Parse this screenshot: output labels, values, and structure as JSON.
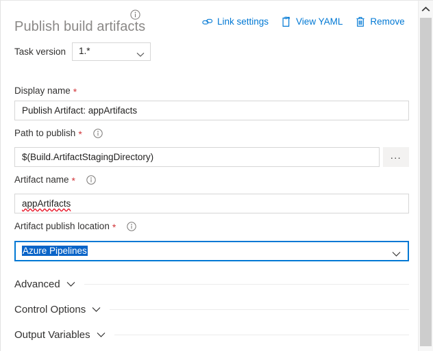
{
  "header": {
    "title": "Publish build artifacts",
    "title_info_icon": "info-icon",
    "toolbar": [
      {
        "label": "Link settings",
        "icon": "link-icon"
      },
      {
        "label": "View YAML",
        "icon": "clipboard-icon"
      },
      {
        "label": "Remove",
        "icon": "trash-icon"
      }
    ]
  },
  "task_version": {
    "label": "Task version",
    "value": "1.*",
    "chevron_icon": "chevron-down-icon"
  },
  "fields": {
    "display_name": {
      "label": "Display name",
      "required_marker": "*",
      "value": "Publish Artifact: appArtifacts"
    },
    "path_to_publish": {
      "label": "Path to publish",
      "required_marker": "*",
      "info_icon": "info-icon",
      "value": "$(Build.ArtifactStagingDirectory)",
      "browse_label": "..."
    },
    "artifact_name": {
      "label": "Artifact name",
      "required_marker": "*",
      "info_icon": "info-icon",
      "value": "appArtifacts"
    },
    "artifact_publish_location": {
      "label": "Artifact publish location",
      "required_marker": "*",
      "info_icon": "info-icon",
      "value": "Azure Pipelines",
      "chevron_icon": "chevron-down-icon"
    }
  },
  "sections": [
    {
      "label": "Advanced",
      "chevron_icon": "chevron-down-icon"
    },
    {
      "label": "Control Options",
      "chevron_icon": "chevron-down-icon"
    },
    {
      "label": "Output Variables",
      "chevron_icon": "chevron-down-icon"
    }
  ],
  "scrollbar": {
    "up_arrow_icon": "chevron-up-icon"
  },
  "colors": {
    "accent_blue": "#0078d4",
    "selection_blue": "#0a64c8",
    "required_red": "#d13438",
    "spellcheck_red": "#e81123",
    "title_gray": "#8a8886"
  }
}
